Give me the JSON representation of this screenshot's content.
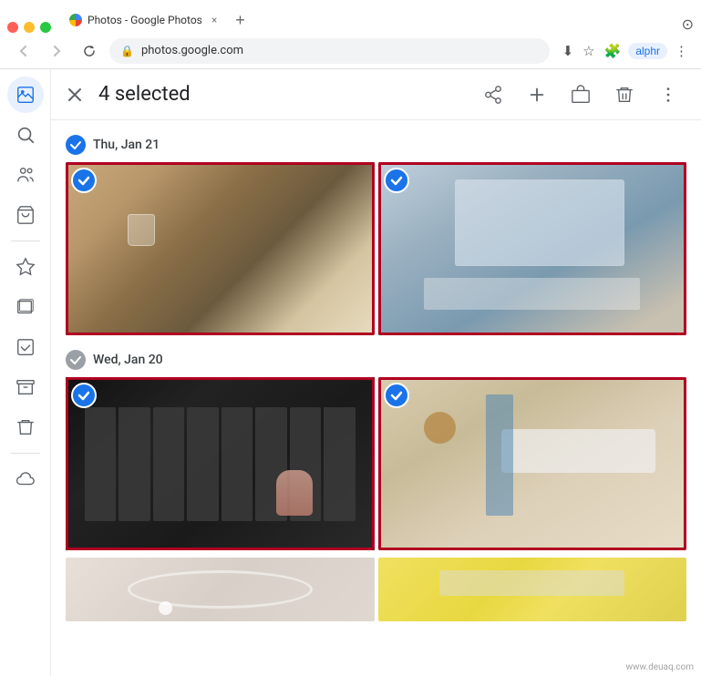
{
  "browser": {
    "tab_title": "Photos - Google Photos",
    "tab_close": "×",
    "tab_new": "+",
    "nav_back": "←",
    "nav_forward": "→",
    "nav_refresh": "↻",
    "url": "photos.google.com",
    "corner_icon": "⊙",
    "nav_icons": [
      "⬇",
      "☆",
      "🧩",
      "alphr",
      "⋮"
    ]
  },
  "header": {
    "selected_count": "4 selected",
    "close_label": "×",
    "actions": {
      "share": "share",
      "add": "+",
      "archive": "🛍",
      "delete": "🗑",
      "more": "⋮"
    }
  },
  "sidebar": {
    "items": [
      {
        "name": "photos",
        "icon": "🖼",
        "active": true
      },
      {
        "name": "search",
        "icon": "🔍",
        "active": false
      },
      {
        "name": "sharing",
        "icon": "👥",
        "active": false
      },
      {
        "name": "shop",
        "icon": "🛍",
        "active": false
      },
      {
        "name": "favorites",
        "icon": "☆",
        "active": false
      },
      {
        "name": "albums",
        "icon": "🖼",
        "active": false
      },
      {
        "name": "utilities",
        "icon": "✓",
        "active": false
      },
      {
        "name": "archive",
        "icon": "⬇",
        "active": false
      },
      {
        "name": "trash",
        "icon": "🗑",
        "active": false
      },
      {
        "name": "cloud",
        "icon": "☁",
        "active": false
      }
    ]
  },
  "sections": [
    {
      "id": "section1",
      "date": "Thu, Jan 21",
      "date_selected": true,
      "photos": [
        {
          "id": "p1",
          "selected": true,
          "has_border": true,
          "class": "photo-1"
        },
        {
          "id": "p2",
          "selected": true,
          "has_border": true,
          "class": "photo-2"
        }
      ]
    },
    {
      "id": "section2",
      "date": "Wed, Jan 20",
      "date_selected": false,
      "photos": [
        {
          "id": "p3",
          "selected": true,
          "has_border": true,
          "class": "photo-3"
        },
        {
          "id": "p4",
          "selected": true,
          "has_border": true,
          "class": "photo-4"
        }
      ]
    },
    {
      "id": "section3",
      "date": "",
      "date_selected": false,
      "photos": [
        {
          "id": "p5",
          "selected": false,
          "has_border": false,
          "class": "photo-5"
        },
        {
          "id": "p6",
          "selected": false,
          "has_border": false,
          "class": "photo-6"
        }
      ],
      "partial": true
    }
  ],
  "watermark": "www.deuaq.com"
}
